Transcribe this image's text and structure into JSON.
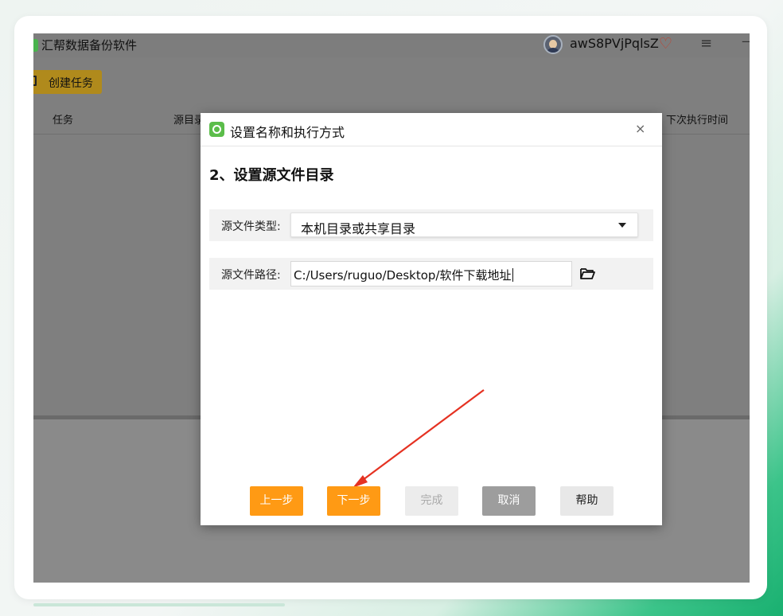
{
  "app": {
    "title": "汇帮数据备份软件",
    "username": "awS8PVjPqlsZ",
    "menu_icon": "≡",
    "minimize_icon": "—",
    "heart_icon": "♡",
    "create_task_label": "创建任务",
    "columns": [
      "任务",
      "源目录",
      "下次执行时间"
    ]
  },
  "dialog": {
    "title": "设置名称和执行方式",
    "close_icon": "×",
    "step_heading": "2、设置源文件目录",
    "source_type": {
      "label": "源文件类型:",
      "value": "本机目录或共享目录"
    },
    "source_path": {
      "label": "源文件路径:",
      "value": "C:/Users/ruguo/Desktop/软件下载地址"
    },
    "buttons": {
      "prev": "上一步",
      "next": "下一步",
      "finish": "完成",
      "cancel": "取消",
      "help": "帮助"
    }
  },
  "colors": {
    "accent_orange": "#ff9a14",
    "annotation_red": "#e53222",
    "brand_green": "#5bbd4a"
  }
}
